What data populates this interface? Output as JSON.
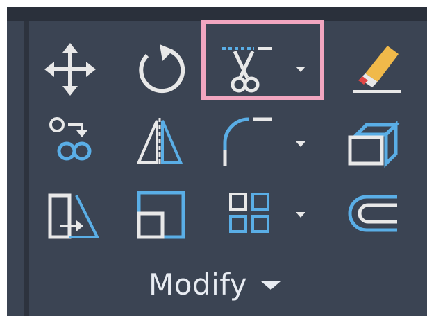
{
  "ribbon_panel": {
    "title": "Modify",
    "tools": [
      {
        "id": "move",
        "icon": "move-icon"
      },
      {
        "id": "rotate",
        "icon": "rotate-icon"
      },
      {
        "id": "trim",
        "icon": "trim-scissors-icon",
        "has_dropdown": true,
        "highlighted": true
      },
      {
        "id": "erase",
        "icon": "eraser-icon"
      },
      {
        "id": "copy",
        "icon": "copy-icon"
      },
      {
        "id": "mirror",
        "icon": "mirror-icon"
      },
      {
        "id": "fillet",
        "icon": "fillet-icon",
        "has_dropdown": true
      },
      {
        "id": "explode",
        "icon": "explode-icon"
      },
      {
        "id": "stretch",
        "icon": "stretch-icon"
      },
      {
        "id": "scale",
        "icon": "scale-icon"
      },
      {
        "id": "array",
        "icon": "array-icon",
        "has_dropdown": true
      },
      {
        "id": "offset",
        "icon": "offset-icon"
      }
    ]
  },
  "colors": {
    "panel_bg": "#3b4453",
    "icon_white": "#e8e8e8",
    "icon_blue": "#5aaee6",
    "highlight": "#f1a6c0",
    "eraser_yellow": "#f0b94a",
    "eraser_red": "#e04646"
  }
}
